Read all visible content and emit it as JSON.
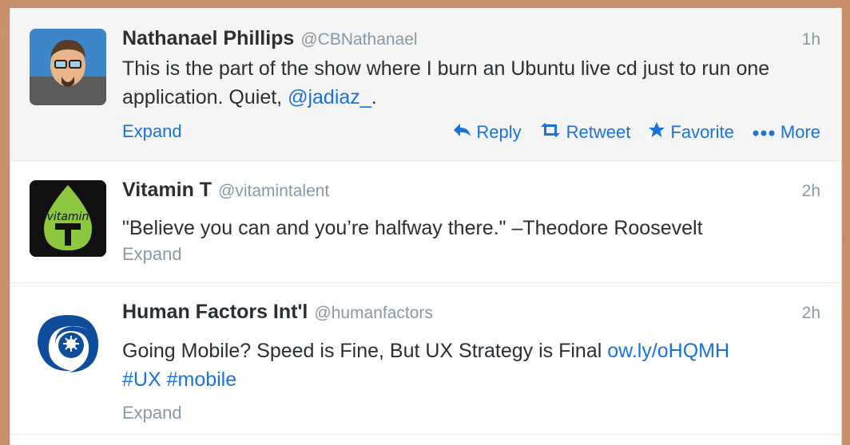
{
  "tweets": [
    {
      "name": "Nathanael Phillips",
      "handle": "@CBNathanael",
      "time": "1h",
      "text_before": "This is the part of the show where I burn an Ubuntu live cd just to run one application. Quiet, ",
      "mention": "@jadiaz_",
      "text_after": ".",
      "expand": "Expand",
      "actions": {
        "reply": "Reply",
        "retweet": "Retweet",
        "favorite": "Favorite",
        "more": "More"
      }
    },
    {
      "name": "Vitamin T",
      "handle": "@vitamintalent",
      "time": "2h",
      "text": "\"Believe you can and you’re halfway there.\"  –Theodore Roosevelt",
      "expand": "Expand",
      "logo_text": "vitamin"
    },
    {
      "name": "Human Factors Int'l",
      "handle": "@humanfactors",
      "time": "2h",
      "text": "Going Mobile? Speed is Fine, But UX Strategy is Final ",
      "link": "ow.ly/oHQMH",
      "hashtag1": "#UX",
      "hashtag2": "#mobile",
      "expand": "Expand"
    }
  ],
  "colors": {
    "link": "#1a73d9",
    "muted": "#8899a6",
    "text": "#292f33",
    "hover_bg": "#f5f5f5"
  }
}
